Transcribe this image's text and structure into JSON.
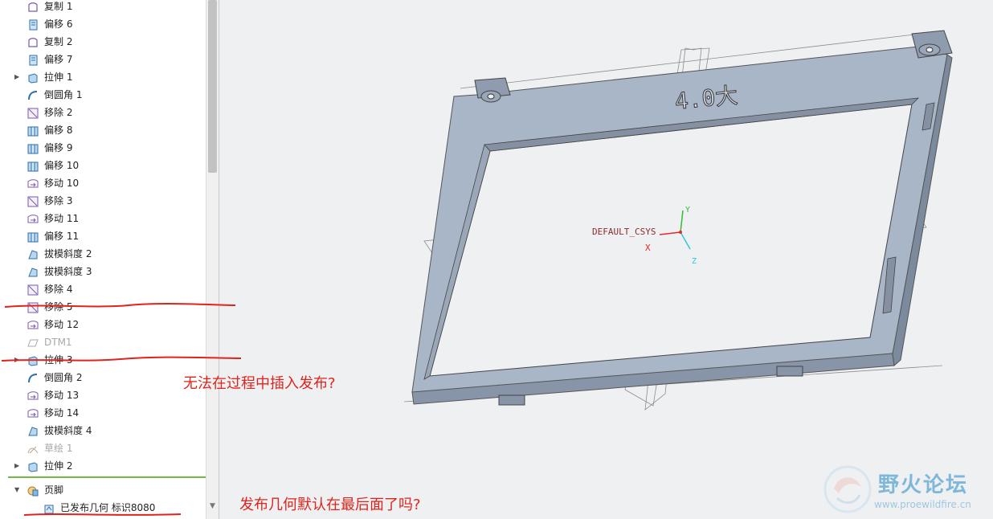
{
  "model_tree": {
    "items": [
      {
        "label": "复制 1",
        "icon": "copy-icon",
        "expandable": false,
        "dim": false
      },
      {
        "label": "偏移 6",
        "icon": "offset-icon",
        "expandable": false,
        "dim": false
      },
      {
        "label": "复制 2",
        "icon": "copy-icon",
        "expandable": false,
        "dim": false
      },
      {
        "label": "偏移 7",
        "icon": "offset-icon",
        "expandable": false,
        "dim": false
      },
      {
        "label": "拉伸 1",
        "icon": "extrude-icon",
        "expandable": true,
        "dim": false
      },
      {
        "label": "倒圆角 1",
        "icon": "round-icon",
        "expandable": false,
        "dim": false
      },
      {
        "label": "移除 2",
        "icon": "remove-icon",
        "expandable": false,
        "dim": false
      },
      {
        "label": "偏移 8",
        "icon": "thicken-icon",
        "expandable": false,
        "dim": false
      },
      {
        "label": "偏移 9",
        "icon": "thicken-icon",
        "expandable": false,
        "dim": false
      },
      {
        "label": "偏移 10",
        "icon": "thicken-icon",
        "expandable": false,
        "dim": false
      },
      {
        "label": "移动 10",
        "icon": "move-icon",
        "expandable": false,
        "dim": false
      },
      {
        "label": "移除 3",
        "icon": "remove-icon",
        "expandable": false,
        "dim": false
      },
      {
        "label": "移动 11",
        "icon": "move-icon",
        "expandable": false,
        "dim": false
      },
      {
        "label": "偏移 11",
        "icon": "thicken-icon",
        "expandable": false,
        "dim": false
      },
      {
        "label": "拔模斜度 2",
        "icon": "draft-icon",
        "expandable": false,
        "dim": false
      },
      {
        "label": "拔模斜度 3",
        "icon": "draft-icon",
        "expandable": false,
        "dim": false
      },
      {
        "label": "移除 4",
        "icon": "remove-icon",
        "expandable": false,
        "dim": false
      },
      {
        "label": "移除 5",
        "icon": "remove-icon",
        "expandable": false,
        "dim": false
      },
      {
        "label": "移动 12",
        "icon": "move-icon",
        "expandable": false,
        "dim": false
      },
      {
        "label": "DTM1",
        "icon": "datum-plane-icon",
        "expandable": false,
        "dim": true
      },
      {
        "label": "拉伸 3",
        "icon": "extrude-icon",
        "expandable": true,
        "dim": false
      },
      {
        "label": "倒圆角 2",
        "icon": "round-icon",
        "expandable": false,
        "dim": false
      },
      {
        "label": "移动 13",
        "icon": "move-icon",
        "expandable": false,
        "dim": false
      },
      {
        "label": "移动 14",
        "icon": "move-icon",
        "expandable": false,
        "dim": false
      },
      {
        "label": "拔模斜度 4",
        "icon": "draft-icon",
        "expandable": false,
        "dim": false
      },
      {
        "label": "草绘 1",
        "icon": "sketch-icon",
        "expandable": false,
        "dim": true
      },
      {
        "label": "拉伸 2",
        "icon": "extrude-icon",
        "expandable": true,
        "dim": false
      }
    ],
    "footer": {
      "label": "页脚",
      "icon": "footer-icon"
    },
    "published": {
      "label": "已发布几何 标识8080",
      "icon": "published-geometry-icon"
    }
  },
  "viewport": {
    "model_text": "4.0大",
    "csys_label": "DEFAULT_CSYS",
    "axis_x": "X",
    "axis_y": "Y",
    "axis_z": "Z"
  },
  "annotations": {
    "question_1": "无法在过程中插入发布?",
    "question_2": "发布几何默认在最后面了吗?"
  },
  "watermark": {
    "title": "野火论坛",
    "url": "www.proewildfire.cn"
  },
  "colors": {
    "annotation_red": "#e0231c",
    "model_top": "#a9b6c8",
    "model_side": "#8895a8",
    "insert_line_green": "#6dbd45"
  }
}
